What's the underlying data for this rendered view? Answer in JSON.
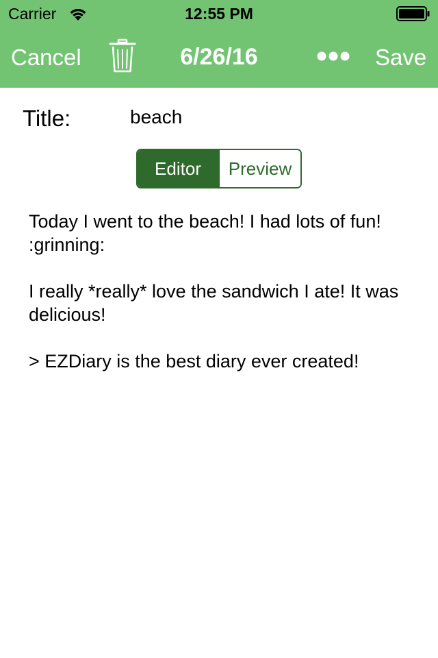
{
  "status_bar": {
    "carrier": "Carrier",
    "time": "12:55 PM",
    "wifi_icon": "wifi-icon",
    "battery_icon": "battery-icon"
  },
  "nav": {
    "cancel_label": "Cancel",
    "trash_icon": "trash-icon",
    "title": "6/26/16",
    "more_icon": "more-icon",
    "save_label": "Save",
    "bar_color": "#72c473"
  },
  "entry": {
    "title_label": "Title:",
    "title_value": "beach",
    "body": "Today I went to the beach! I had lots of fun! :grinning:\n\nI really *really* love the sandwich I ate! It was delicious!\n\n> EZDiary is the best diary ever created!"
  },
  "mode_switch": {
    "editor_label": "Editor",
    "preview_label": "Preview",
    "selected": "Editor",
    "accent_color": "#2e6a2c"
  }
}
